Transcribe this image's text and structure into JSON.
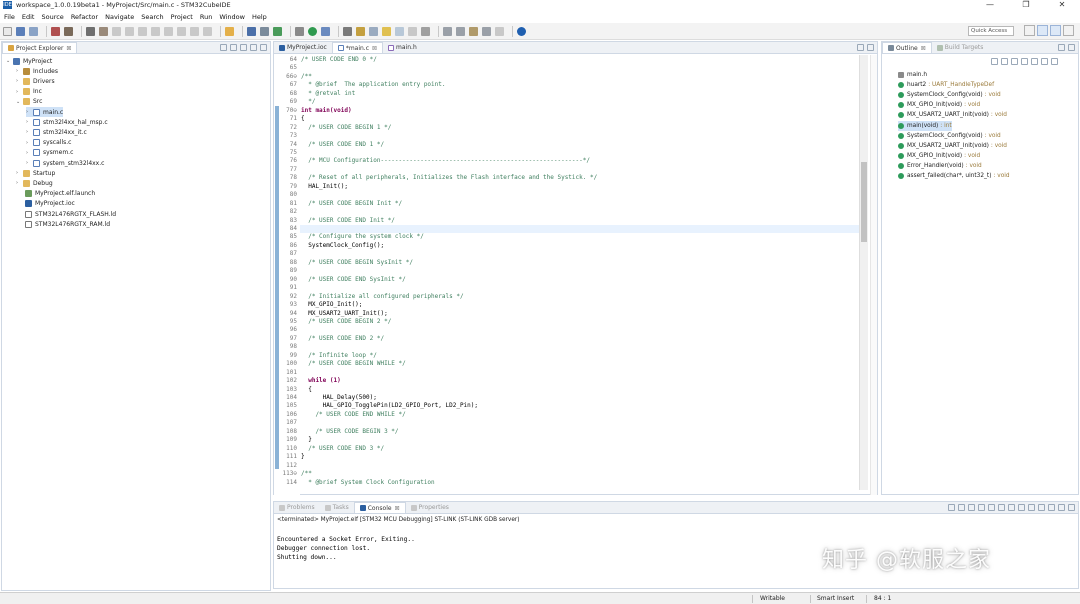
{
  "window": {
    "title": "workspace_1.0.0.19beta1 - MyProject/Src/main.c - STM32CubeIDE",
    "controls": [
      "—",
      "❐",
      "✕"
    ]
  },
  "menu": [
    "File",
    "Edit",
    "Source",
    "Refactor",
    "Navigate",
    "Search",
    "Project",
    "Run",
    "Window",
    "Help"
  ],
  "toolbar": {
    "quick_access": "Quick Access"
  },
  "explorer": {
    "tab": "Project Explorer",
    "tree": [
      {
        "label": "MyProject",
        "icon": "project-icon",
        "twisty": "⌄"
      },
      {
        "label": "Includes",
        "icon": "includes-icon",
        "twisty": "›"
      },
      {
        "label": "Drivers",
        "icon": "folder-icon",
        "twisty": "›"
      },
      {
        "label": "Inc",
        "icon": "folder-icon",
        "twisty": "›"
      },
      {
        "label": "Src",
        "icon": "folder-icon",
        "twisty": "⌄"
      },
      {
        "label": "main.c",
        "icon": "c-file-icon",
        "twisty": "›"
      },
      {
        "label": "stm32l4xx_hal_msp.c",
        "icon": "c-file-icon",
        "twisty": "›"
      },
      {
        "label": "stm32l4xx_it.c",
        "icon": "c-file-icon",
        "twisty": "›"
      },
      {
        "label": "syscalls.c",
        "icon": "c-file-icon",
        "twisty": "›"
      },
      {
        "label": "sysmem.c",
        "icon": "c-file-icon",
        "twisty": "›"
      },
      {
        "label": "system_stm32l4xx.c",
        "icon": "c-file-icon",
        "twisty": "›"
      },
      {
        "label": "Startup",
        "icon": "folder-icon",
        "twisty": "›"
      },
      {
        "label": "Debug",
        "icon": "folder-icon",
        "twisty": "›"
      },
      {
        "label": "MyProject.elf.launch",
        "icon": "launch-file-icon",
        "twisty": ""
      },
      {
        "label": "MyProject.ioc",
        "icon": "ioc-file-icon",
        "twisty": ""
      },
      {
        "label": "STM32L476RGTX_FLASH.ld",
        "icon": "ld-file-icon",
        "twisty": ""
      },
      {
        "label": "STM32L476RGTX_RAM.ld",
        "icon": "ld-file-icon",
        "twisty": ""
      }
    ]
  },
  "editor": {
    "tabs": [
      {
        "label": "MyProject.ioc"
      },
      {
        "label": "*main.c"
      },
      {
        "label": "main.h"
      }
    ],
    "lines": [
      {
        "n": "64",
        "t": "/* USER CODE END 0 */",
        "c": "cm"
      },
      {
        "n": "65",
        "t": "",
        "c": ""
      },
      {
        "n": "66⊖",
        "t": "/**",
        "c": "cm"
      },
      {
        "n": "67",
        "t": "  * @brief  The application entry point.",
        "c": "cm"
      },
      {
        "n": "68",
        "t": "  * @retval int",
        "c": "cm"
      },
      {
        "n": "69",
        "t": "  */",
        "c": "cm"
      },
      {
        "n": "70⊖",
        "t": "int main(void)",
        "c": "kw"
      },
      {
        "n": "71",
        "t": "{",
        "c": ""
      },
      {
        "n": "72",
        "t": "  /* USER CODE BEGIN 1 */",
        "c": "cm"
      },
      {
        "n": "73",
        "t": "",
        "c": ""
      },
      {
        "n": "74",
        "t": "  /* USER CODE END 1 */",
        "c": "cm"
      },
      {
        "n": "75",
        "t": "",
        "c": ""
      },
      {
        "n": "76",
        "t": "  /* MCU Configuration--------------------------------------------------------*/",
        "c": "cm"
      },
      {
        "n": "77",
        "t": "",
        "c": ""
      },
      {
        "n": "78",
        "t": "  /* Reset of all peripherals, Initializes the Flash interface and the Systick. */",
        "c": "cm"
      },
      {
        "n": "79",
        "t": "  HAL_Init();",
        "c": ""
      },
      {
        "n": "80",
        "t": "",
        "c": ""
      },
      {
        "n": "81",
        "t": "  /* USER CODE BEGIN Init */",
        "c": "cm"
      },
      {
        "n": "82",
        "t": "",
        "c": ""
      },
      {
        "n": "83",
        "t": "  /* USER CODE END Init */",
        "c": "cm"
      },
      {
        "n": "84",
        "t": "",
        "c": ""
      },
      {
        "n": "85",
        "t": "  /* Configure the system clock */",
        "c": "cm"
      },
      {
        "n": "86",
        "t": "  SystemClock_Config();",
        "c": ""
      },
      {
        "n": "87",
        "t": "",
        "c": ""
      },
      {
        "n": "88",
        "t": "  /* USER CODE BEGIN SysInit */",
        "c": "cm"
      },
      {
        "n": "89",
        "t": "",
        "c": ""
      },
      {
        "n": "90",
        "t": "  /* USER CODE END SysInit */",
        "c": "cm"
      },
      {
        "n": "91",
        "t": "",
        "c": ""
      },
      {
        "n": "92",
        "t": "  /* Initialize all configured peripherals */",
        "c": "cm"
      },
      {
        "n": "93",
        "t": "  MX_GPIO_Init();",
        "c": ""
      },
      {
        "n": "94",
        "t": "  MX_USART2_UART_Init();",
        "c": ""
      },
      {
        "n": "95",
        "t": "  /* USER CODE BEGIN 2 */",
        "c": "cm"
      },
      {
        "n": "96",
        "t": "",
        "c": ""
      },
      {
        "n": "97",
        "t": "  /* USER CODE END 2 */",
        "c": "cm"
      },
      {
        "n": "98",
        "t": "",
        "c": ""
      },
      {
        "n": "99",
        "t": "  /* Infinite loop */",
        "c": "cm"
      },
      {
        "n": "100",
        "t": "  /* USER CODE BEGIN WHILE */",
        "c": "cm"
      },
      {
        "n": "101",
        "t": "",
        "c": ""
      },
      {
        "n": "102",
        "t": "  while (1)",
        "c": "kw"
      },
      {
        "n": "103",
        "t": "  {",
        "c": ""
      },
      {
        "n": "104",
        "t": "      HAL_Delay(500);",
        "c": ""
      },
      {
        "n": "105",
        "t": "      HAL_GPIO_TogglePin(LD2_GPIO_Port, LD2_Pin);",
        "c": ""
      },
      {
        "n": "106",
        "t": "    /* USER CODE END WHILE */",
        "c": "cm"
      },
      {
        "n": "107",
        "t": "",
        "c": ""
      },
      {
        "n": "108",
        "t": "    /* USER CODE BEGIN 3 */",
        "c": "cm"
      },
      {
        "n": "109",
        "t": "  }",
        "c": ""
      },
      {
        "n": "110",
        "t": "  /* USER CODE END 3 */",
        "c": "cm"
      },
      {
        "n": "111",
        "t": "}",
        "c": ""
      },
      {
        "n": "112",
        "t": "",
        "c": ""
      },
      {
        "n": "113⊖",
        "t": "/**",
        "c": "cm"
      },
      {
        "n": "114",
        "t": "  * @brief System Clock Configuration",
        "c": "cm"
      }
    ]
  },
  "outline": {
    "tabs": [
      {
        "label": "Outline"
      },
      {
        "label": "Build Targets"
      }
    ],
    "items": [
      {
        "name": "main.h",
        "type": "",
        "color": "#8a8a8a"
      },
      {
        "name": "huart2",
        "type": ": UART_HandleTypeDef",
        "color": "#2e9b5b"
      },
      {
        "name": "SystemClock_Config(void)",
        "type": ": void",
        "color": "#2e9b5b"
      },
      {
        "name": "MX_GPIO_Init(void)",
        "type": ": void",
        "color": "#2e9b5b"
      },
      {
        "name": "MX_USART2_UART_Init(void)",
        "type": ": void",
        "color": "#2e9b5b"
      },
      {
        "name": "main(void)",
        "type": ": int",
        "color": "#2e9b5b"
      },
      {
        "name": "SystemClock_Config(void)",
        "type": ": void",
        "color": "#2e9b5b"
      },
      {
        "name": "MX_USART2_UART_Init(void)",
        "type": ": void",
        "color": "#2e9b5b"
      },
      {
        "name": "MX_GPIO_Init(void)",
        "type": ": void",
        "color": "#2e9b5b"
      },
      {
        "name": "Error_Handler(void)",
        "type": ": void",
        "color": "#2e9b5b"
      },
      {
        "name": "assert_failed(char*, uint32_t)",
        "type": ": void",
        "color": "#2e9b5b"
      }
    ]
  },
  "console": {
    "tabs": [
      {
        "label": "Problems"
      },
      {
        "label": "Tasks"
      },
      {
        "label": "Console"
      },
      {
        "label": "Properties"
      }
    ],
    "header": "<terminated> MyProject.elf [STM32 MCU Debugging] ST-LINK (ST-LINK GDB server)",
    "lines": [
      "Encountered a Socket Error, Exiting..",
      "Debugger connection lost.",
      "Shutting down..."
    ]
  },
  "status": {
    "writable": "Writable",
    "insert_mode": "Smart Insert",
    "position": "84 : 1"
  },
  "watermark": "知乎 @软服之家"
}
